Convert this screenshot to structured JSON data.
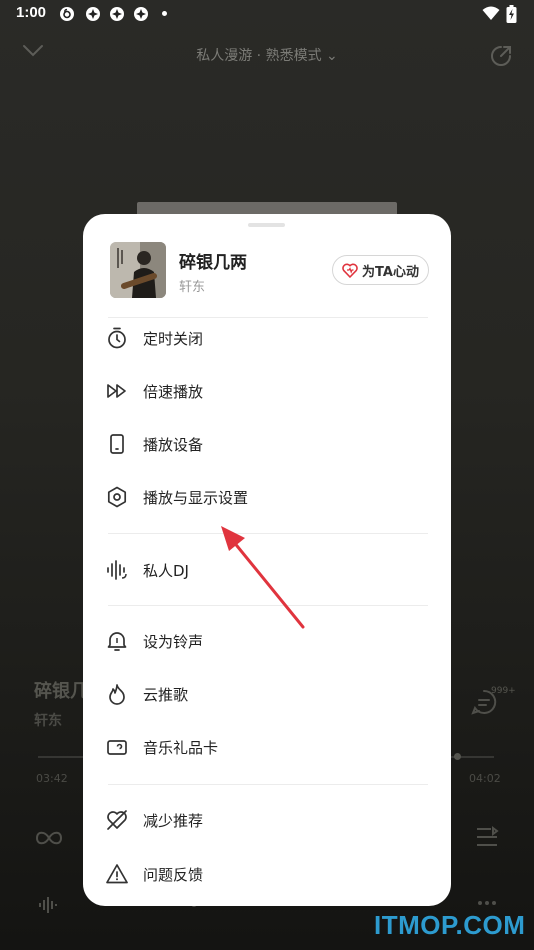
{
  "status_bar": {
    "time": "1:00"
  },
  "player": {
    "mode_label": "私人漫游 · 熟悉模式",
    "song_title_partial": "碎银几",
    "artist_partial": "轩东",
    "comment_count": "999+",
    "progress_fraction": 0.92,
    "current_time": "03:42",
    "total_time": "04:02"
  },
  "sheet": {
    "song": {
      "title": "碎银几两",
      "artist": "轩东"
    },
    "heart_button_label": "为TA心动",
    "menu_items": [
      {
        "label": "定时关闭",
        "icon": "timer-icon"
      },
      {
        "label": "倍速播放",
        "icon": "fast-forward-icon"
      },
      {
        "label": "播放设备",
        "icon": "device-icon"
      },
      {
        "label": "播放与显示设置",
        "icon": "settings-hexagon-icon"
      },
      {
        "label": "私人DJ",
        "icon": "soundwave-icon"
      },
      {
        "label": "设为铃声",
        "icon": "ringtone-icon"
      },
      {
        "label": "云推歌",
        "icon": "cloud-recommend-icon"
      },
      {
        "label": "音乐礼品卡",
        "icon": "gift-card-icon"
      },
      {
        "label": "减少推荐",
        "icon": "heart-slash-icon"
      },
      {
        "label": "问题反馈",
        "icon": "warning-icon"
      }
    ]
  },
  "watermark": "ITMOP.COM",
  "colors": {
    "accent_red": "#e0343e",
    "watermark_blue": "#2d9bcf"
  }
}
